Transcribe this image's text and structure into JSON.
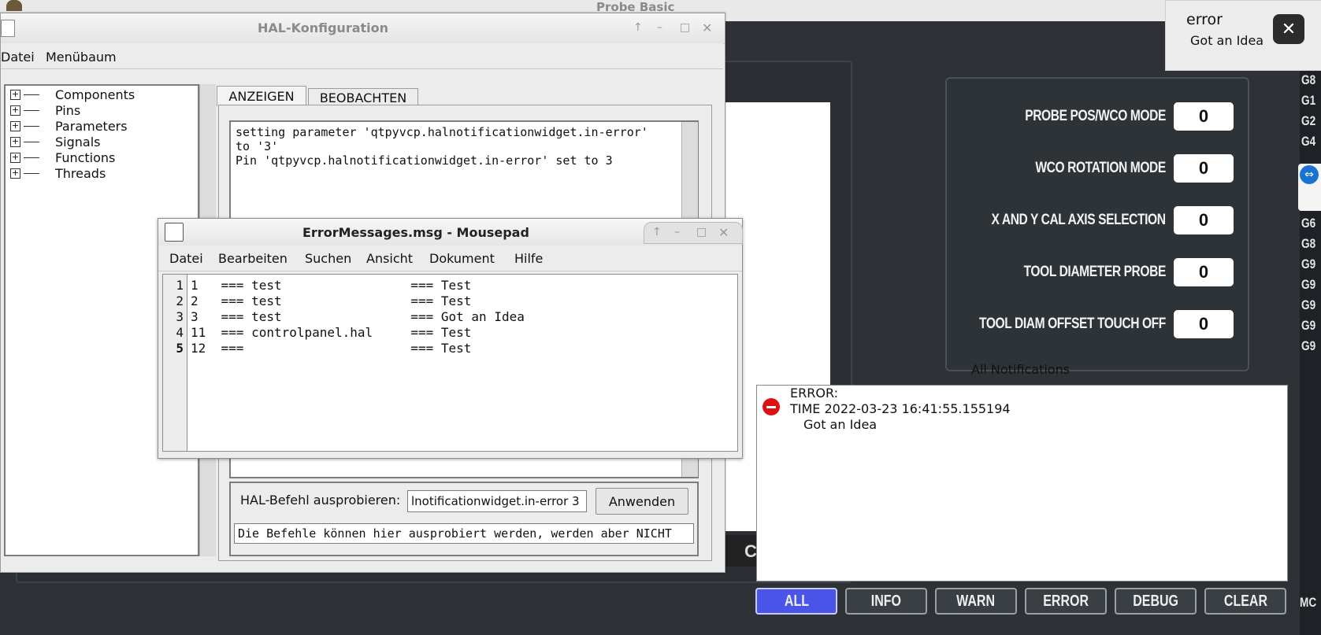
{
  "probe_basic": {
    "title": "Probe Basic",
    "params": [
      {
        "label": "PROBE POS/WCO MODE",
        "value": "0"
      },
      {
        "label": "WCO ROTATION MODE",
        "value": "0"
      },
      {
        "label": "X AND Y CAL AXIS SELECTION",
        "value": "0"
      },
      {
        "label": "TOOL DIAMETER PROBE",
        "value": "0"
      },
      {
        "label": "TOOL DIAM OFFSET TOUCH OFF",
        "value": "0"
      }
    ],
    "gcode_column": [
      "G8",
      "G1",
      "G2",
      "G4",
      "G6",
      "G8",
      "G9",
      "G9",
      "G9",
      "G9",
      "G9"
    ],
    "gcode_bottom": "MC",
    "mid_strip_letter": "C",
    "notifications": {
      "label": "All Notifications",
      "entry": {
        "title": "ERROR:",
        "time": "TIME 2022-03-23 16:41:55.155194",
        "message": "Got an Idea"
      }
    },
    "filter_buttons": [
      "ALL",
      "INFO",
      "WARN",
      "ERROR",
      "DEBUG",
      "CLEAR"
    ],
    "active_filter": "ALL"
  },
  "popup": {
    "title": "error",
    "message": "Got an Idea",
    "close": "✕"
  },
  "hal": {
    "title": "HAL-Konfiguration",
    "menus": [
      "Datei",
      "Menübaum"
    ],
    "tree": [
      "Components",
      "Pins",
      "Parameters",
      "Signals",
      "Functions",
      "Threads"
    ],
    "tabs": [
      "ANZEIGEN",
      "BEOBACHTEN"
    ],
    "output_lines": [
      "setting parameter 'qtpyvcp.halnotificationwidget.in-error'",
      "to '3'",
      "Pin 'qtpyvcp.halnotificationwidget.in-error' set to 3"
    ],
    "cmd_label": "HAL-Befehl ausprobieren:",
    "cmd_value": "lnotificationwidget.in-error 3",
    "apply_label": "Anwenden",
    "hint": "Die Befehle können hier ausprobiert werden, werden aber NICHT"
  },
  "mousepad": {
    "title": "ErrorMessages.msg - Mousepad",
    "menus": [
      "Datei",
      "Bearbeiten",
      "Suchen",
      "Ansicht",
      "Dokument",
      "Hilfe"
    ],
    "line_numbers": [
      "1",
      "2",
      "3",
      "4",
      "5"
    ],
    "current_line": 5,
    "lines": [
      "1   === test                 === Test",
      "2   === test                 === Test",
      "3   === test                 === Got an Idea",
      "11  === controlpanel.hal     === Test",
      "12  ===                      === Test"
    ]
  },
  "window_controls": {
    "up": "↑",
    "min": "–",
    "max": "□",
    "close": "✕"
  }
}
